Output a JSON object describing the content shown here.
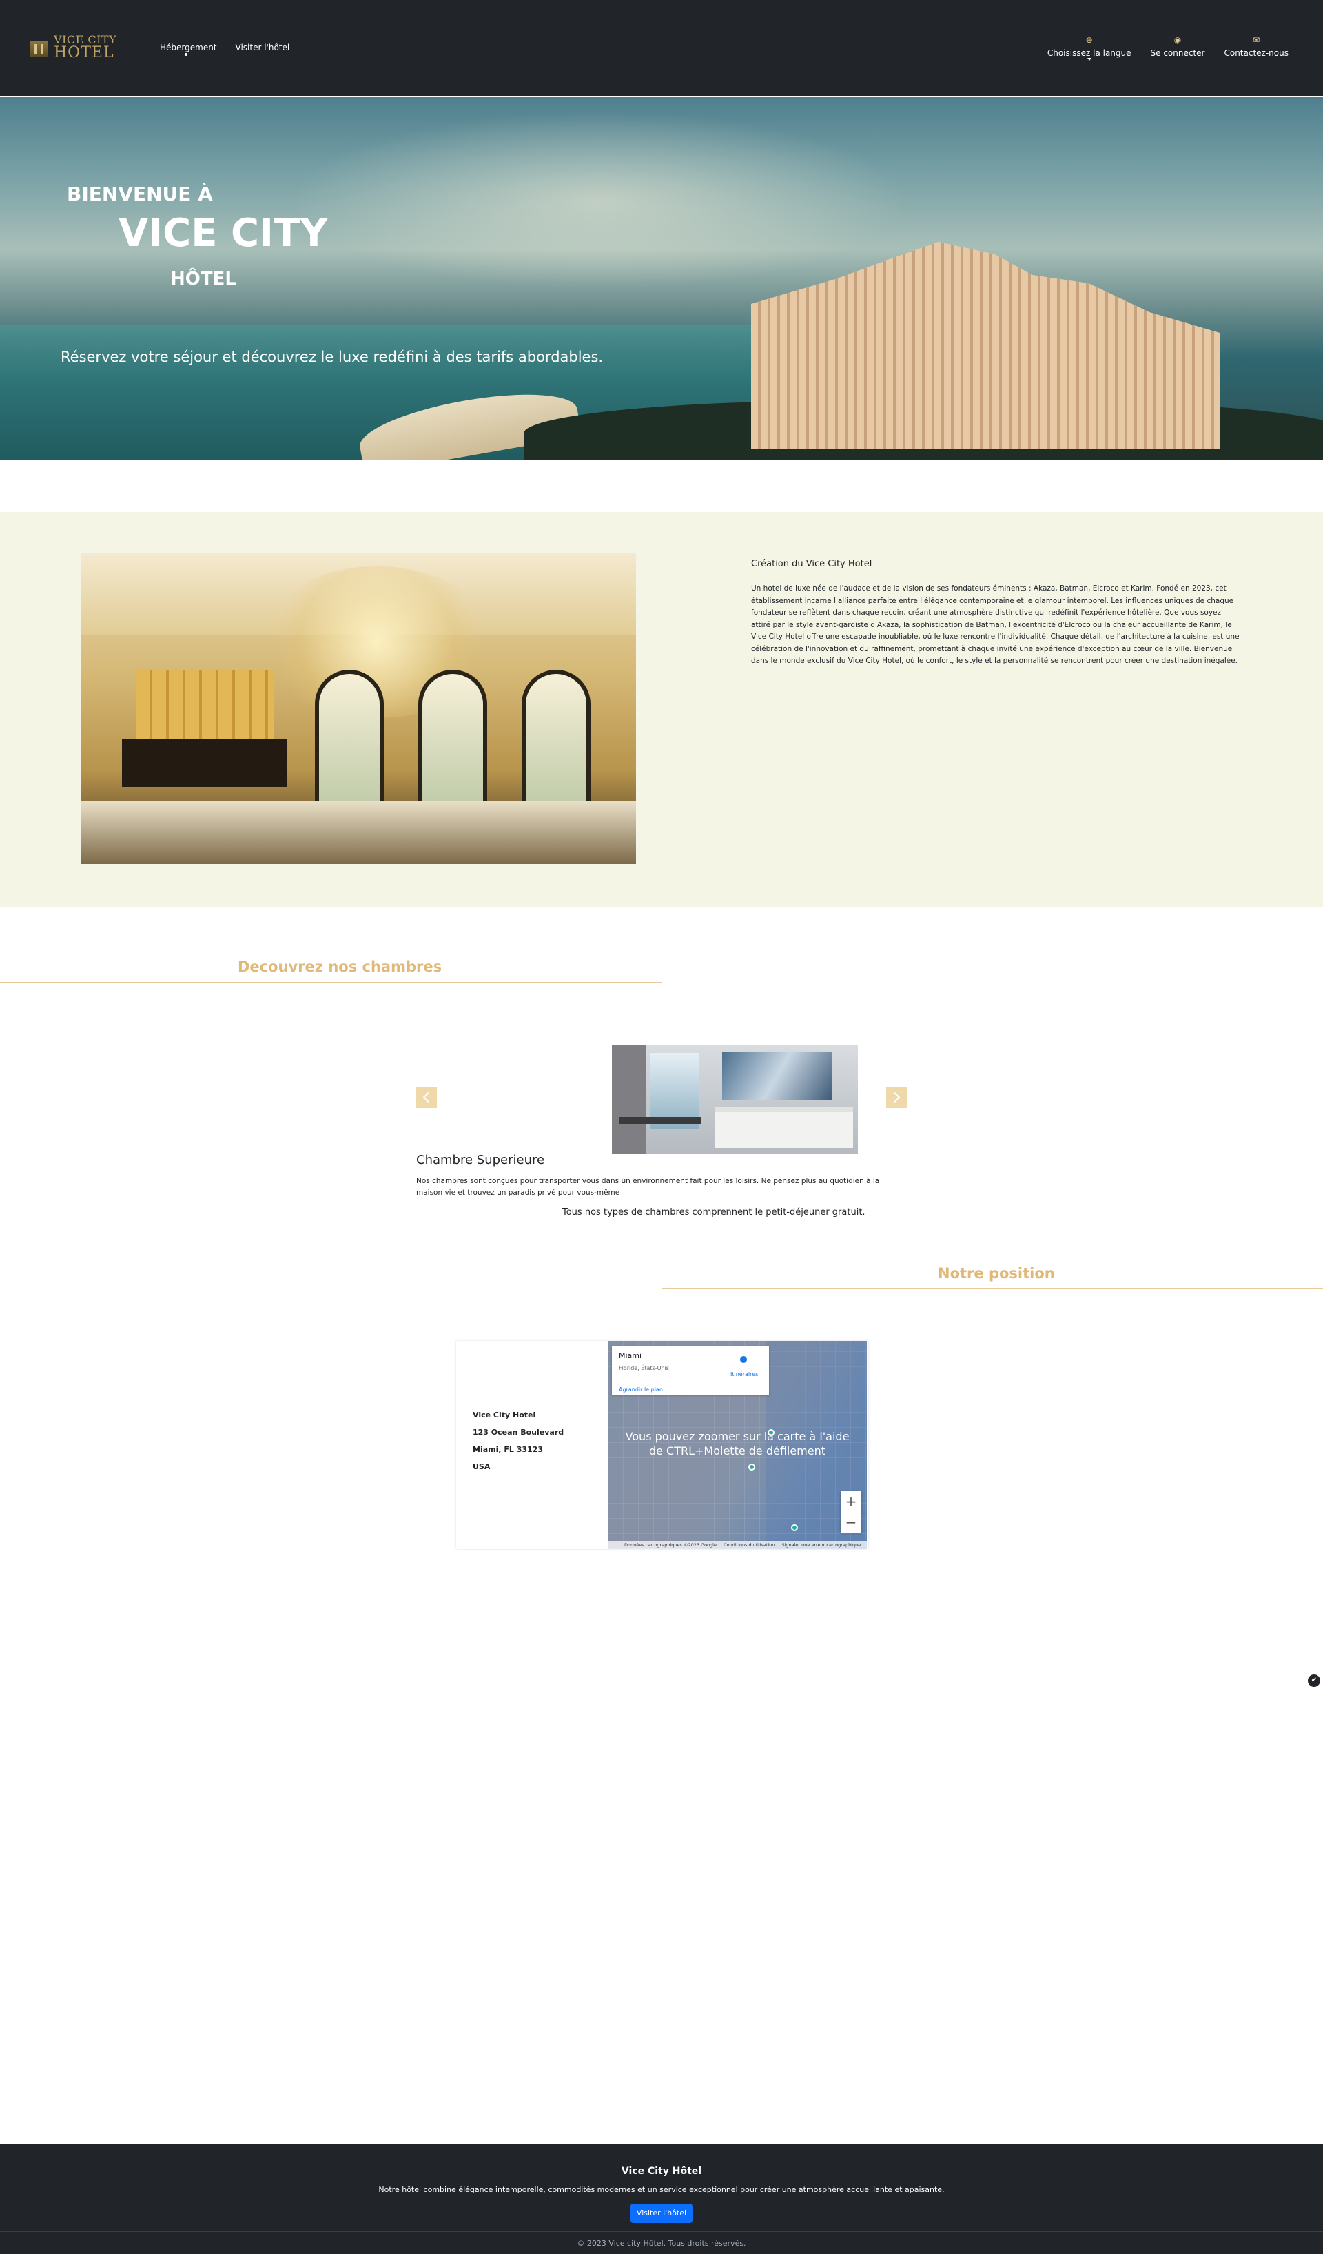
{
  "navbar": {
    "logo_top": "VICE CITY",
    "logo_bottom": "HOTEL",
    "links": [
      "Hébergement",
      "Visiter l'hôtel"
    ],
    "language_label": "Choisissez la langue",
    "login_label": "Se connecter",
    "contact_label": "Contactez-nous"
  },
  "hero": {
    "line1": "BIENVENUE À",
    "line2": "VICE CITY",
    "line3": "HÔTEL",
    "subtitle": "Réservez votre séjour et découvrez le luxe redéfini à des tarifs abordables."
  },
  "about": {
    "title": "Création du Vice City Hotel",
    "text": "Un hotel de luxe née de l'audace et de la vision de ses fondateurs éminents : Akaza, Batman, Elcroco et Karim. Fondé en 2023, cet établissement incarne l'alliance parfaite entre l'élégance contemporaine et le glamour intemporel. Les influences uniques de chaque fondateur se reflètent dans chaque recoin, créant une atmosphère distinctive qui redéfinit l'expérience hôtelière. Que vous soyez attiré par le style avant-gardiste d'Akaza, la sophistication de Batman, l'excentricité d'Elcroco ou la chaleur accueillante de Karim, le Vice City Hotel offre une escapade inoubliable, où le luxe rencontre l'individualité. Chaque détail, de l'architecture à la cuisine, est une célébration de l'innovation et du raffinement, promettant à chaque invité une expérience d'exception au cœur de la ville. Bienvenue dans le monde exclusif du Vice City Hotel, où le confort, le style et la personnalité se rencontrent pour créer une destination inégalée."
  },
  "rooms": {
    "title": "Decouvrez nos chambres",
    "room_name": "Chambre Superieure",
    "room_desc": "Nos chambres sont conçues pour transporter vous dans un environnement fait pour les loisirs. Ne pensez plus au quotidien à la maison vie et trouvez un paradis privé pour vous-même",
    "breakfast_note": "Tous nos types de chambres comprennent le petit-déjeuner gratuit."
  },
  "position": {
    "title": "Notre position",
    "address": [
      "Vice City Hotel",
      "123 Ocean Boulevard",
      "Miami, FL 33123",
      "USA"
    ],
    "map": {
      "city": "Miami",
      "region": "Floride, États-Unis",
      "enlarge_link": "Agrandir le plan",
      "directions": "Itinéraires",
      "message": "Vous pouvez zoomer sur la carte à l'aide de CTRL+Molette de défilement",
      "zoom_in": "+",
      "zoom_out": "−",
      "attribution": [
        "Données cartographiques ©2023 Google",
        "Conditions d'utilisation",
        "Signaler une erreur cartographique"
      ]
    }
  },
  "footer": {
    "title": "Vice City Hôtel",
    "text": "Notre hôtel combine élégance intemporelle, commodités modernes et un service exceptionnel pour créer une atmosphère accueillante et apaisante.",
    "button": "Visiter l'hôtel",
    "copyright": "© 2023 Vice city Hôtel. Tous droits réservés."
  },
  "icons": {
    "language": "globe-icon",
    "login": "user-circle-icon",
    "contact": "envelope-icon",
    "prev": "chevron-left-icon",
    "next": "chevron-right-icon"
  },
  "colors": {
    "navbar_bg": "#212529",
    "accent_gold": "#e0b878",
    "about_bg": "#f5f5e6",
    "primary_button": "#0d6efd"
  }
}
